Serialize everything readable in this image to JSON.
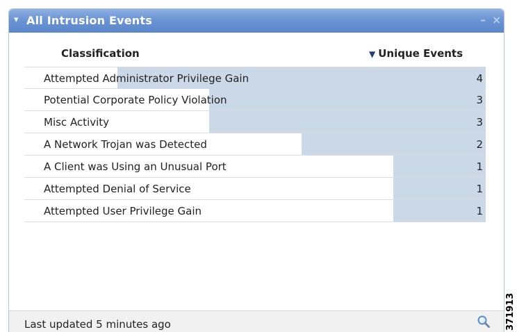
{
  "widget": {
    "title": "All Intrusion Events",
    "collapse_icon": "▾",
    "minimize_icon": "–",
    "close_icon": "×"
  },
  "table": {
    "columns": {
      "classification": "Classification",
      "sort_indicator": "▼",
      "unique_events": "Unique Events"
    },
    "max_value": 4,
    "rows": [
      {
        "label": "Attempted Administrator Privilege Gain",
        "count": "4",
        "value": 4
      },
      {
        "label": "Potential Corporate Policy Violation",
        "count": "3",
        "value": 3
      },
      {
        "label": "Misc Activity",
        "count": "3",
        "value": 3
      },
      {
        "label": "A Network Trojan was Detected",
        "count": "2",
        "value": 2
      },
      {
        "label": "A Client was Using an Unusual Port",
        "count": "1",
        "value": 1
      },
      {
        "label": "Attempted Denial of Service",
        "count": "1",
        "value": 1
      },
      {
        "label": "Attempted User Privilege Gain",
        "count": "1",
        "value": 1
      }
    ]
  },
  "footer": {
    "status": "Last updated 5 minutes ago",
    "icon": "search-icon"
  },
  "figure_id": "371913",
  "colors": {
    "title_bar": "#6b94d4",
    "bar_fill": "#cad8e8"
  }
}
